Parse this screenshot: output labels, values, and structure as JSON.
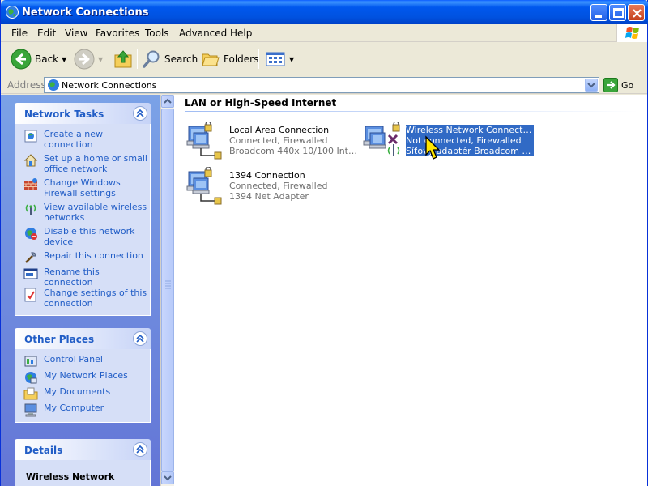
{
  "window": {
    "title": "Network Connections"
  },
  "menu": {
    "file": "File",
    "edit": "Edit",
    "view": "View",
    "favorites": "Favorites",
    "tools": "Tools",
    "advanced": "Advanced",
    "help": "Help"
  },
  "toolbar": {
    "back": "Back",
    "search": "Search",
    "folders": "Folders"
  },
  "address": {
    "label": "Address",
    "value": "Network Connections",
    "go": "Go"
  },
  "network_tasks": {
    "title": "Network Tasks",
    "items": [
      {
        "label": "Create a new connection",
        "icon": "new-connection-icon"
      },
      {
        "label": "Set up a home or small office network",
        "icon": "home-network-icon"
      },
      {
        "label": "Change Windows Firewall settings",
        "icon": "firewall-icon"
      },
      {
        "label": "View available wireless networks",
        "icon": "wireless-icon"
      },
      {
        "label": "Disable this network device",
        "icon": "disable-device-icon"
      },
      {
        "label": "Repair this connection",
        "icon": "repair-icon"
      },
      {
        "label": "Rename this connection",
        "icon": "rename-icon"
      },
      {
        "label": "Change settings of this connection",
        "icon": "settings-icon"
      }
    ]
  },
  "other_places": {
    "title": "Other Places",
    "items": [
      {
        "label": "Control Panel",
        "icon": "control-panel-icon"
      },
      {
        "label": "My Network Places",
        "icon": "network-places-icon"
      },
      {
        "label": "My Documents",
        "icon": "documents-icon"
      },
      {
        "label": "My Computer",
        "icon": "computer-icon"
      }
    ]
  },
  "details": {
    "title": "Details",
    "name": "Wireless Network"
  },
  "content": {
    "group_title": "LAN or High-Speed Internet",
    "connections": [
      {
        "name": "Local Area Connection",
        "status": "Connected, Firewalled",
        "device": "Broadcom 440x 10/100 Integr..."
      },
      {
        "name": "Wireless Network Connection",
        "status": "Not connected, Firewalled",
        "device": "Síťový adaptér Broadcom 802...."
      },
      {
        "name": "1394 Connection",
        "status": "Connected, Firewalled",
        "device": "1394 Net Adapter"
      }
    ]
  },
  "colors": {
    "titlebar": "#0054e3",
    "taskpane_link": "#215dc6",
    "selection": "#316ac5"
  }
}
